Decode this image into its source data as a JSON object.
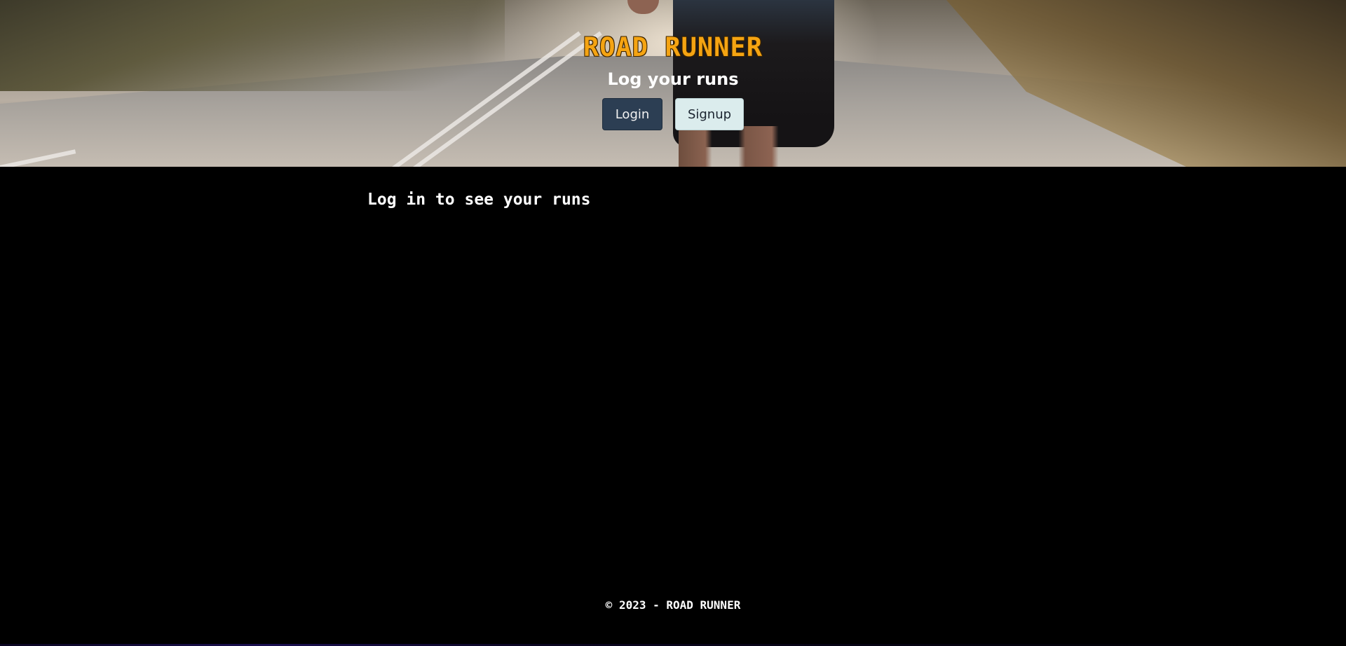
{
  "header": {
    "title": "ROAD RUNNER",
    "tagline": "Log your runs",
    "login_label": "Login",
    "signup_label": "Signup"
  },
  "main": {
    "prompt": "Log in to see your runs"
  },
  "footer": {
    "text": "© 2023 - ROAD RUNNER"
  },
  "colors": {
    "title": "#f5a412",
    "login_button": "#2c3e53",
    "signup_button": "#dbeced",
    "page_background": "#000000"
  }
}
